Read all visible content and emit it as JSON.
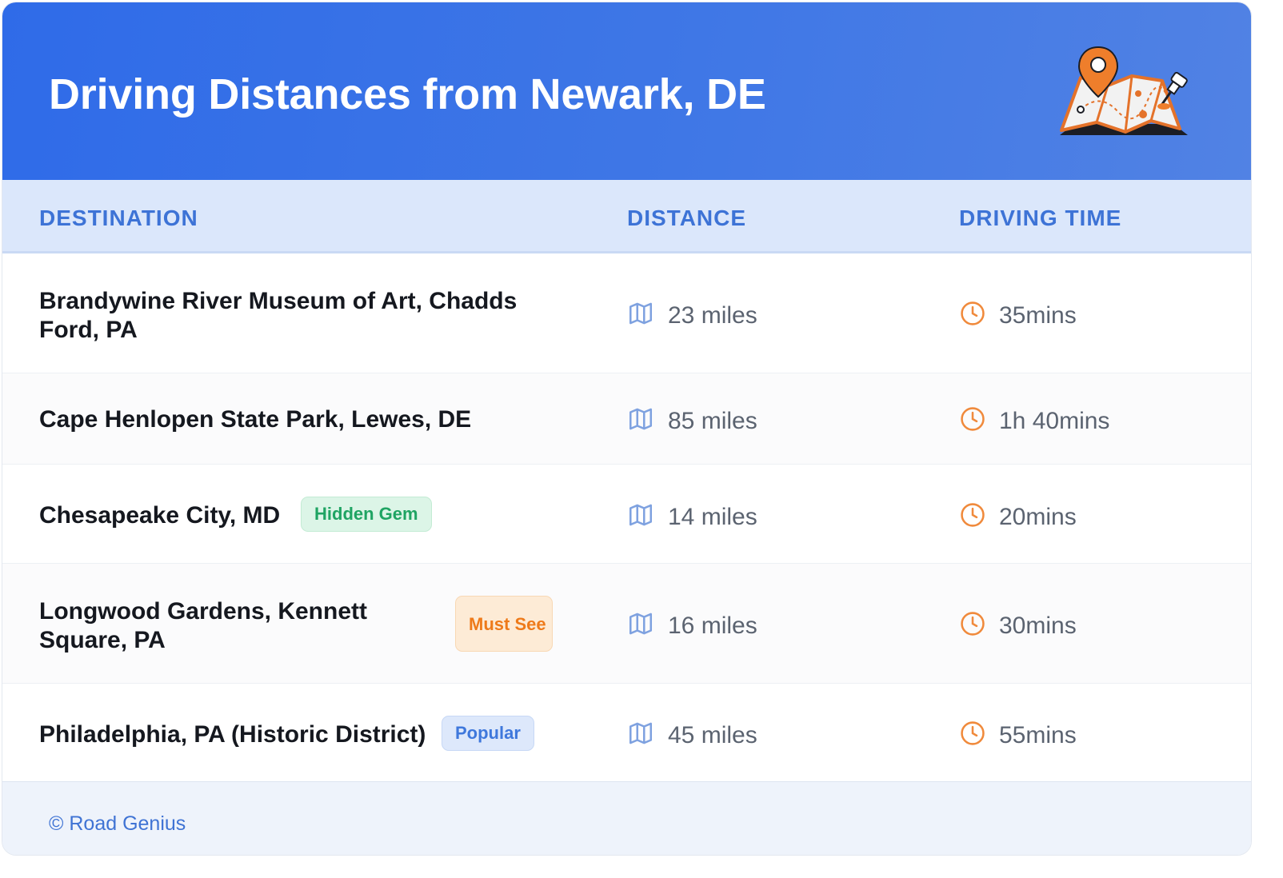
{
  "header": {
    "title": "Driving Distances from Newark, DE",
    "illustration": "map-with-pins-icon"
  },
  "table": {
    "columns": [
      "DESTINATION",
      "DISTANCE",
      "DRIVING TIME"
    ],
    "rows": [
      {
        "destination": "Brandywine River Museum of Art, Chadds Ford, PA",
        "badge": null,
        "distance": "23 miles",
        "time": "35mins"
      },
      {
        "destination": "Cape Henlopen State Park, Lewes, DE",
        "badge": null,
        "distance": "85 miles",
        "time": "1h 40mins"
      },
      {
        "destination": "Chesapeake City, MD",
        "badge": "Hidden Gem",
        "distance": "14 miles",
        "time": "20mins"
      },
      {
        "destination": "Longwood Gardens, Kennett Square, PA",
        "badge": "Must See",
        "distance": "16 miles",
        "time": "30mins"
      },
      {
        "destination": "Philadelphia, PA (Historic District)",
        "badge": "Popular",
        "distance": "45 miles",
        "time": "55mins"
      }
    ]
  },
  "icons": {
    "distance": "map-icon",
    "time": "clock-icon"
  },
  "footer": {
    "text": "© Road Genius"
  },
  "colors": {
    "header_gradient_start": "#2f6be8",
    "header_gradient_end": "#5182e4",
    "column_header_text": "#3d73d6",
    "distance_icon": "#7fa2e0",
    "time_icon": "#f08a3c",
    "badge_hidden_gem": "#1fa463",
    "badge_must_see": "#ee7a1a",
    "badge_popular": "#3f78dc"
  }
}
